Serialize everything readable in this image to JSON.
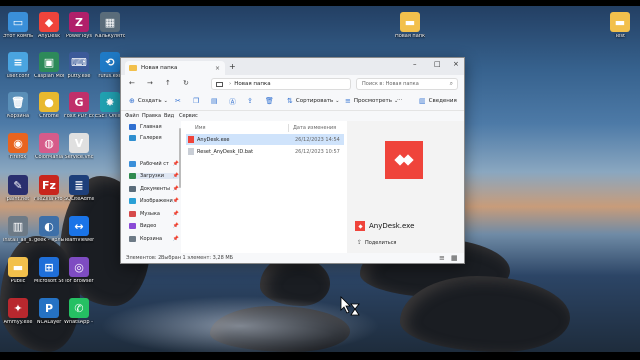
{
  "desktop_icons": [
    {
      "label": "Этот компьютер",
      "glyph": "▭",
      "color": "#3a8fd9"
    },
    {
      "label": "AnyDesk",
      "glyph": "◆",
      "color": "#ef443b"
    },
    {
      "label": "PowerToys",
      "glyph": "Z",
      "color": "#b0206a"
    },
    {
      "label": "Калькулятор - ярлык",
      "glyph": "▦",
      "color": "#5a6c7a"
    },
    {
      "label": "user.conf",
      "glyph": "≡",
      "color": "#4aa4e0"
    },
    {
      "label": "Caspian Monet Ga...",
      "glyph": "▣",
      "color": "#2d8a5a"
    },
    {
      "label": "putty.exe",
      "glyph": "⌨",
      "color": "#3c5a99"
    },
    {
      "label": "rufus.exe",
      "glyph": "⟲",
      "color": "#1f7ac6"
    },
    {
      "label": "Корзина",
      "glyph": "🗑",
      "color": "#5a8fb8"
    },
    {
      "label": "Chrome",
      "glyph": "●",
      "color": "#e8b92f"
    },
    {
      "label": "Foxit PDF Editor",
      "glyph": "G",
      "color": "#c0306a"
    },
    {
      "label": "ESET Online Scanner",
      "glyph": "✸",
      "color": "#21a0b0"
    },
    {
      "label": "Firefox",
      "glyph": "◉",
      "color": "#e8641f"
    },
    {
      "label": "ColorMania",
      "glyph": "◍",
      "color": "#d65b8a"
    },
    {
      "label": "Service.vnc",
      "glyph": "V",
      "color": "#e0e0e0"
    },
    {
      "label": "paint.net",
      "glyph": "✎",
      "color": "#2a2f6e"
    },
    {
      "label": "FileZilla Pro - ярлык (2)",
      "glyph": "Fz",
      "color": "#c8261d"
    },
    {
      "label": "SQLiteAdmin - ярлык",
      "glyph": "≣",
      "color": "#1d3f7a"
    },
    {
      "label": "install_all_s...",
      "glyph": "▥",
      "color": "#6d7a86"
    },
    {
      "label": "geek - ярлык",
      "glyph": "◐",
      "color": "#3d6fa8"
    },
    {
      "label": "TeamViewer",
      "glyph": "↔",
      "color": "#1a74e8"
    },
    {
      "label": "Public",
      "glyph": "▬",
      "color": "#f2c04c"
    },
    {
      "label": "Microsoft Store - ярлык",
      "glyph": "⊞",
      "color": "#1f6fd9"
    },
    {
      "label": "Tor Browser",
      "glyph": "◎",
      "color": "#7e4cc2"
    },
    {
      "label": "Ammyy.exe",
      "glyph": "✦",
      "color": "#b8282e"
    },
    {
      "label": "NCALayer",
      "glyph": "P",
      "color": "#2572c4"
    },
    {
      "label": "WhatsApp - ярлык",
      "glyph": "✆",
      "color": "#25c063"
    },
    {
      "label": "Новая папка",
      "glyph": "▬",
      "color": "#f2c04c"
    },
    {
      "label": "Test",
      "glyph": "▬",
      "color": "#f2c04c"
    }
  ],
  "explorer": {
    "tab_title": "Новая папка",
    "breadcrumb_current": "Новая папка",
    "search_placeholder": "Поиск в: Новая папка",
    "commands": {
      "create": "Создать",
      "sort": "Сортировать",
      "view": "Просмотреть",
      "details": "Сведения"
    },
    "menu": [
      "Файл",
      "Правка",
      "Вид",
      "Сервис"
    ],
    "sidebar": [
      {
        "label": "Главная",
        "color": "#2f6fd0"
      },
      {
        "label": "Галерея",
        "color": "#2f8fd0"
      },
      {
        "label": "Рабочий ст",
        "color": "#3a8fd9"
      },
      {
        "label": "Загрузки",
        "color": "#2f8a4f"
      },
      {
        "label": "Документы",
        "color": "#5a6c7a"
      },
      {
        "label": "Изображени",
        "color": "#2aa0d6"
      },
      {
        "label": "Музыка",
        "color": "#d64a4a"
      },
      {
        "label": "Видео",
        "color": "#8a4ad6"
      },
      {
        "label": "Корзина",
        "color": "#6d7a86"
      }
    ],
    "columns": {
      "name": "Имя",
      "date": "Дата изменения"
    },
    "files": [
      {
        "name": "AnyDesk.exe",
        "date": "26/12/2023 14:54",
        "selected": true
      },
      {
        "name": "Reset_AnyDesk_ID.bat",
        "date": "26/12/2023 10:57",
        "selected": false
      }
    ],
    "preview": {
      "name": "AnyDesk.exe",
      "share_label": "Поделиться"
    },
    "status": {
      "count": "Элементов: 2",
      "selection": "Выбран 1 элемент: 3,28 МБ"
    }
  }
}
